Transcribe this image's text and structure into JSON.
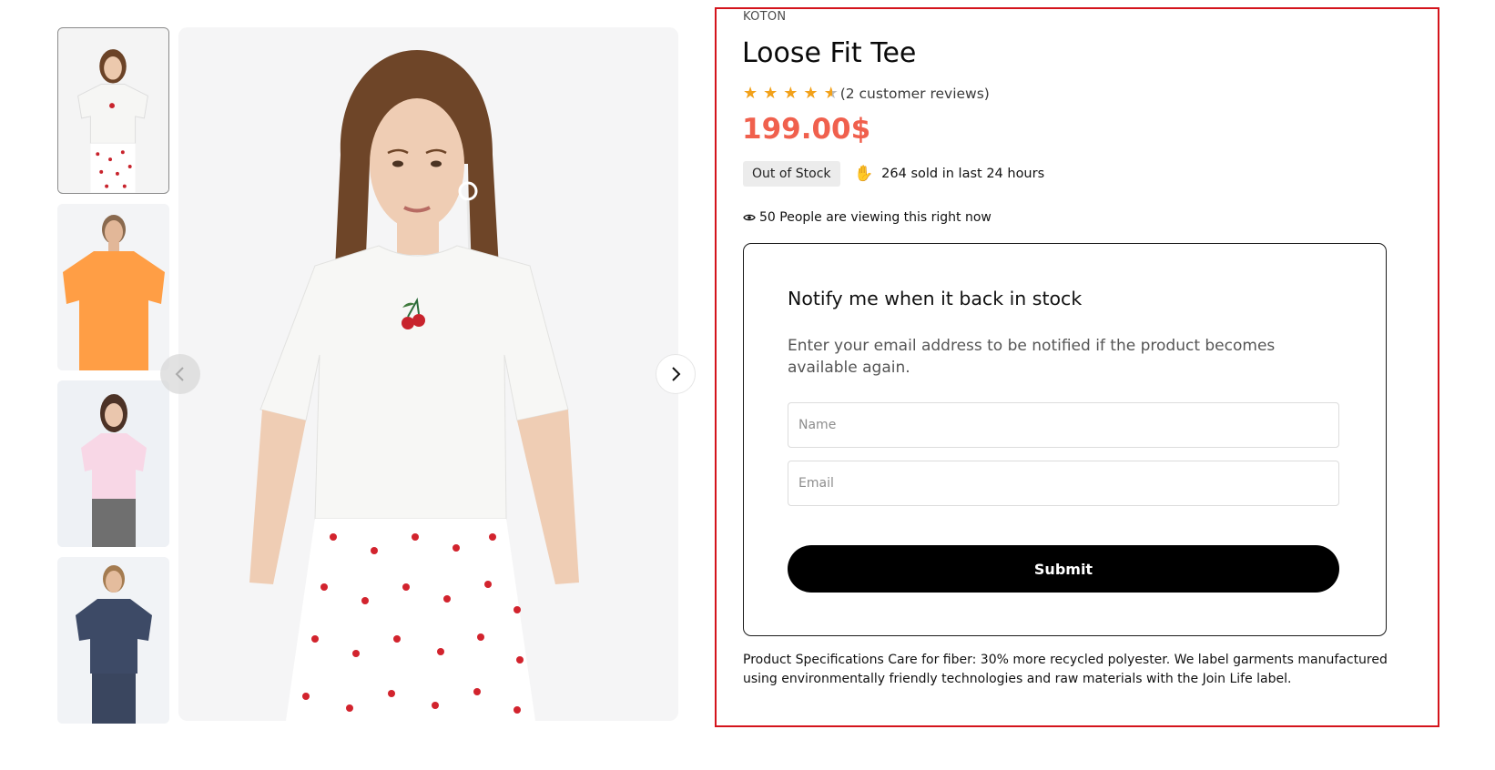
{
  "gallery": {
    "thumbnails": [
      {
        "name": "thumb-white-tee",
        "shirt_color": "#f4f4f2",
        "bottom_color": "#ffffff"
      },
      {
        "name": "thumb-orange-tee",
        "shirt_color": "#ff9e45",
        "bottom_color": "#ffffff"
      },
      {
        "name": "thumb-pink-tee",
        "shirt_color": "#f8d7e6",
        "bottom_color": "#6f6f6f"
      },
      {
        "name": "thumb-navy-tee",
        "shirt_color": "#3d4a66",
        "bottom_color": "#3d4a66"
      }
    ],
    "prev_icon": "chevron-left-icon",
    "next_icon": "chevron-right-icon"
  },
  "product": {
    "brand": "KOTON",
    "title": "Loose Fit Tee",
    "rating": 4.5,
    "reviews_label": "(2 customer reviews)",
    "price": "199.00$",
    "stock_status": "Out of Stock",
    "sold_icon": "hand-icon",
    "sold_text": "264 sold in last 24 hours",
    "viewing_icon": "eye-icon",
    "viewing_text": "50 People are viewing this right now",
    "specs": "Product Specifications Care for fiber: 30% more recycled polyester. We label garments manufactured using environmentally friendly technologies and raw materials with the Join Life label."
  },
  "notify": {
    "title": "Notify me when it back in stock",
    "description": "Enter your email address to be notified if the product becomes available again.",
    "name_placeholder": "Name",
    "email_placeholder": "Email",
    "submit_label": "Submit"
  },
  "colors": {
    "price": "#f0604d",
    "star": "#f2a11a",
    "highlight_border": "#d4141c",
    "button_bg": "#000000"
  }
}
